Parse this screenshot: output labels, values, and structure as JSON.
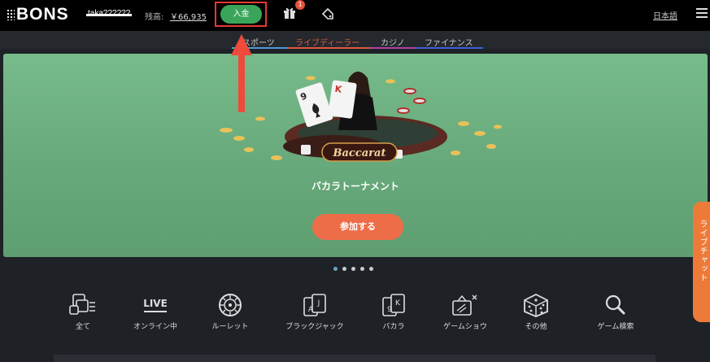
{
  "header": {
    "logo_text": "BONS",
    "username": "taka??????",
    "balance_label": "残高:",
    "balance_value": "￥66,935",
    "deposit_label": "入金",
    "gift_badge": "1",
    "language": "日本語"
  },
  "nav": {
    "tabs": [
      {
        "label": "スポーツ",
        "color": "#4f9ad6"
      },
      {
        "label": "ライブディーラー",
        "color": "#e0573c"
      },
      {
        "label": "カジノ",
        "color": "#b041a3"
      },
      {
        "label": "ファイナンス",
        "color": "#3f5fd6"
      }
    ]
  },
  "banner": {
    "title": "バカラトーナメント",
    "join_label": "参加する",
    "art_text": "Baccarat",
    "card1_rank": "9",
    "card2_rank": "K",
    "slides": 5,
    "active_slide": 1
  },
  "live_chat": {
    "label": "ライブチャット"
  },
  "categories": [
    {
      "label": "全て",
      "icon": "all-games-icon"
    },
    {
      "label": "オンライン中",
      "icon": "live-icon",
      "icon_text": "LIVE"
    },
    {
      "label": "ルーレット",
      "icon": "roulette-icon"
    },
    {
      "label": "ブラックジャック",
      "icon": "blackjack-cards-icon",
      "icon_text_1": "A",
      "icon_text_2": "J"
    },
    {
      "label": "バカラ",
      "icon": "baccarat-cards-icon",
      "icon_text_1": "9",
      "icon_text_2": "K"
    },
    {
      "label": "ゲームショウ",
      "icon": "game-show-tv-icon"
    },
    {
      "label": "その他",
      "icon": "dice-icon"
    },
    {
      "label": "ゲーム検索",
      "icon": "search-icon"
    }
  ],
  "colors": {
    "topbar": "#000000",
    "deposit_green": "#3aa55a",
    "annotation_red": "#e53935",
    "join_orange": "#ee6d49",
    "chat_orange": "#ee7a3a",
    "banner_green": "#6aac7d"
  }
}
